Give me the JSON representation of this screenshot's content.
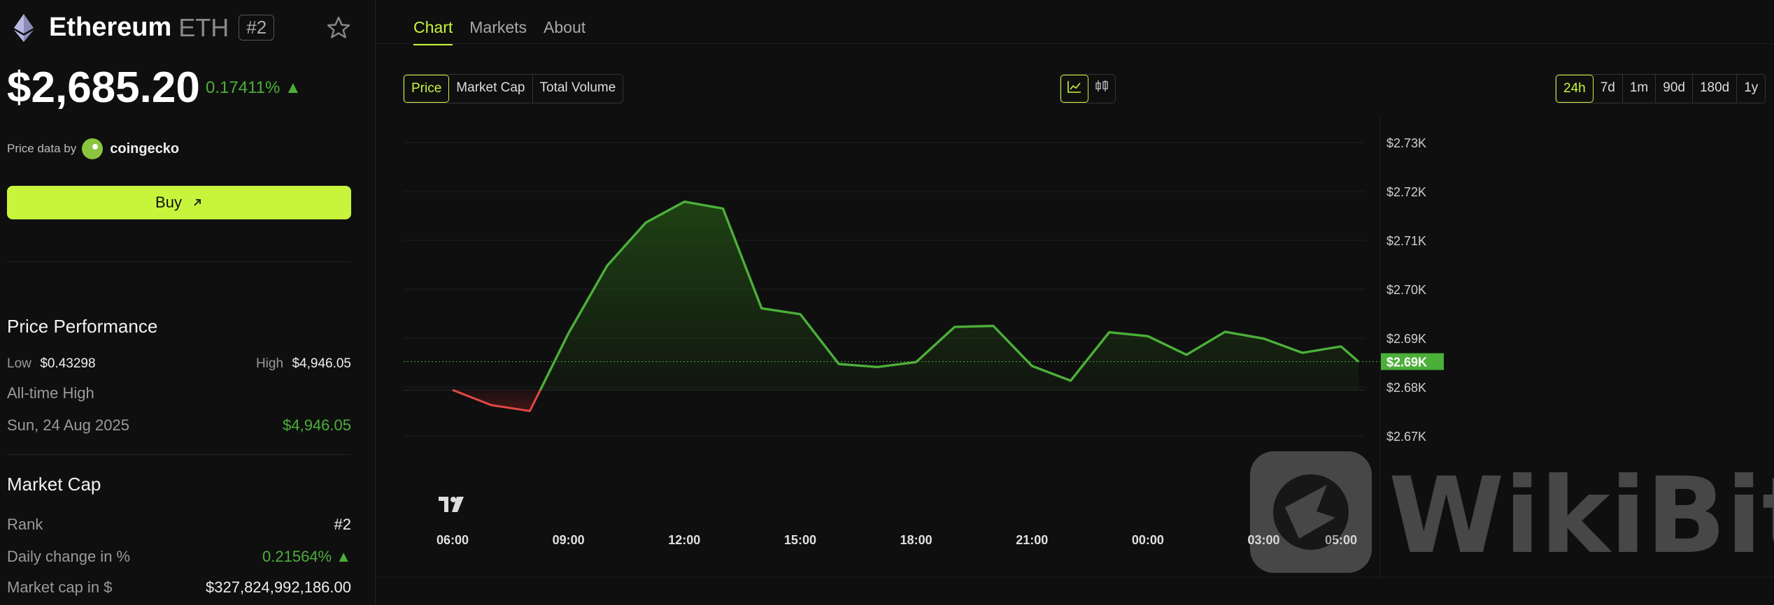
{
  "coin": {
    "name": "Ethereum",
    "symbol": "ETH",
    "rank_badge": "#2",
    "price": "$2,685.20",
    "change": "0.17411% ▲",
    "price_data_label": "Price data by",
    "source": "coingecko",
    "buy_label": "Buy"
  },
  "performance": {
    "title": "Price Performance",
    "low_label": "Low",
    "low_value": "$0.43298",
    "high_label": "High",
    "high_value": "$4,946.05",
    "ath_label": "All-time High",
    "ath_date": "Sun, 24 Aug 2025",
    "ath_value": "$4,946.05"
  },
  "market_cap": {
    "title": "Market Cap",
    "rank_label": "Rank",
    "rank_value": "#2",
    "daily_label": "Daily change in %",
    "daily_value": "0.21564% ▲",
    "cap_label": "Market cap in $",
    "cap_value": "$327,824,992,186.00"
  },
  "tabs": [
    "Chart",
    "Markets",
    "About"
  ],
  "active_tab": "Chart",
  "metric_buttons": [
    "Price",
    "Market Cap",
    "Total Volume"
  ],
  "active_metric": "Price",
  "chart_type_icons": [
    "line-chart-icon",
    "candlestick-icon"
  ],
  "ranges": [
    "24h",
    "7d",
    "1m",
    "90d",
    "180d",
    "1y"
  ],
  "active_range": "24h",
  "colors": {
    "accent": "#c8f53c",
    "up": "#4caf3a",
    "down": "#e04848",
    "background": "#0f0f0f"
  },
  "chart_data": {
    "type": "line",
    "x": [
      "06:00",
      "07:00",
      "08:00",
      "09:00",
      "10:00",
      "11:00",
      "12:00",
      "13:00",
      "14:00",
      "15:00",
      "16:00",
      "17:00",
      "18:00",
      "19:00",
      "20:00",
      "21:00",
      "22:00",
      "23:00",
      "00:00",
      "01:00",
      "02:00",
      "03:00",
      "04:00",
      "05:00",
      "06:00"
    ],
    "y": [
      2679.4,
      2676.3,
      2675.1,
      2691.0,
      2704.8,
      2713.6,
      2717.9,
      2716.5,
      2696.1,
      2694.9,
      2684.7,
      2684.1,
      2685.1,
      2692.3,
      2692.5,
      2684.3,
      2681.3,
      2691.2,
      2690.4,
      2686.6,
      2691.3,
      2689.9,
      2687.0,
      2688.3,
      2685.2
    ],
    "x_ticks": [
      "06:00",
      "09:00",
      "12:00",
      "15:00",
      "18:00",
      "21:00",
      "00:00",
      "03:00",
      "05:00"
    ],
    "y_ticks": [
      "$2.73K",
      "$2.72K",
      "$2.71K",
      "$2.70K",
      "$2.69K",
      "$2.68K",
      "$2.67K"
    ],
    "ylim": [
      2670,
      2730
    ],
    "current_price_label": "$2.69K",
    "current_price": 2685.2,
    "start_price": 2679.4,
    "grid": true
  }
}
